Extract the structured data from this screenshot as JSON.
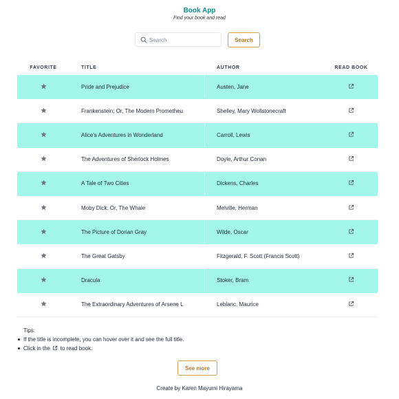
{
  "header": {
    "title": "Book App",
    "subtitle": "Find your book and read"
  },
  "search": {
    "placeholder": "Search",
    "value": "",
    "button_label": "Search"
  },
  "table": {
    "columns": [
      "FAVORITE",
      "TITLE",
      "AUTHOR",
      "READ BOOK"
    ],
    "rows": [
      {
        "title": "Pride and Prejudice",
        "author": "Austen, Jane"
      },
      {
        "title": "Frankenstein; Or, The Modern Prometheu",
        "author": "Shelley, Mary Wollstonecraft"
      },
      {
        "title": "Alice's Adventures in Wonderland",
        "author": "Carroll, Lewis"
      },
      {
        "title": "The Adventures of Sherlock Holmes",
        "author": "Doyle, Arthur Conan"
      },
      {
        "title": "A Tale of Two Cities",
        "author": "Dickens, Charles"
      },
      {
        "title": "Moby Dick; Or, The Whale",
        "author": "Melville, Herman"
      },
      {
        "title": "The Picture of Dorian Gray",
        "author": "Wilde, Oscar"
      },
      {
        "title": "The Great Gatsby",
        "author": "Fitzgerald, F. Scott (Francis Scott)"
      },
      {
        "title": "Dracula",
        "author": "Stoker, Bram"
      },
      {
        "title": "The Extraordinary Adventures of Arsene L",
        "author": "Leblanc, Maurice"
      }
    ]
  },
  "tips": {
    "title": "Tips:",
    "item1": "If the title is incomplete, you can hover over it and see the full title.",
    "item2_before": "Click in the",
    "item2_after": "to read book."
  },
  "see_more_label": "See more",
  "footer": "Create by Karen Mayumi Hirayama",
  "colors": {
    "accent": "#0e8a8a",
    "row_highlight": "#a3f7ea",
    "button": "#b7791f"
  },
  "icons": {
    "search": "search-icon",
    "favorite": "star-icon",
    "read": "external-link-icon"
  }
}
